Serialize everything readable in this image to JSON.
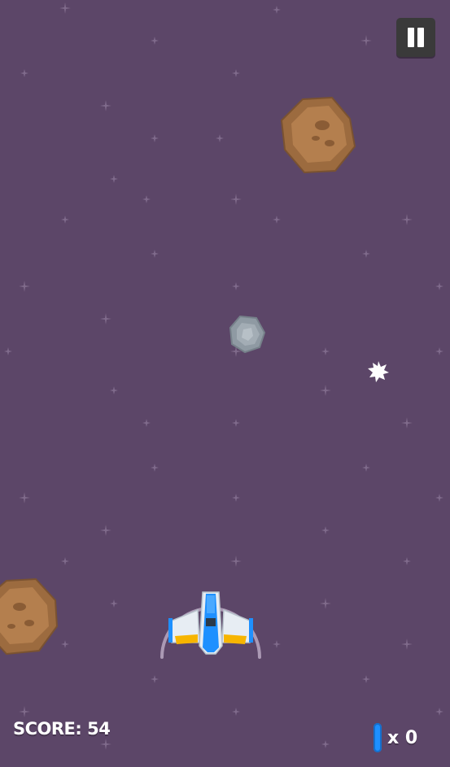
{
  "hud": {
    "score_text": "SCORE: 54",
    "shield_count_text": "x 0"
  },
  "icons": {
    "pause": "pause-icon",
    "shield_powerup": "shield-pill-icon",
    "player": "spaceship-icon",
    "meteor": "meteor-icon",
    "star": "star-icon"
  },
  "colors": {
    "background": "#5c4668",
    "meteor_brown": "#9c6b3f",
    "meteor_grey": "#8f9aa3",
    "ship_body": "#e7edf3",
    "ship_accent": "#1e90ff",
    "ship_thruster": "#f7b500",
    "shield_pill": "#1e90ff",
    "pause_button": "#3a3a3a"
  }
}
